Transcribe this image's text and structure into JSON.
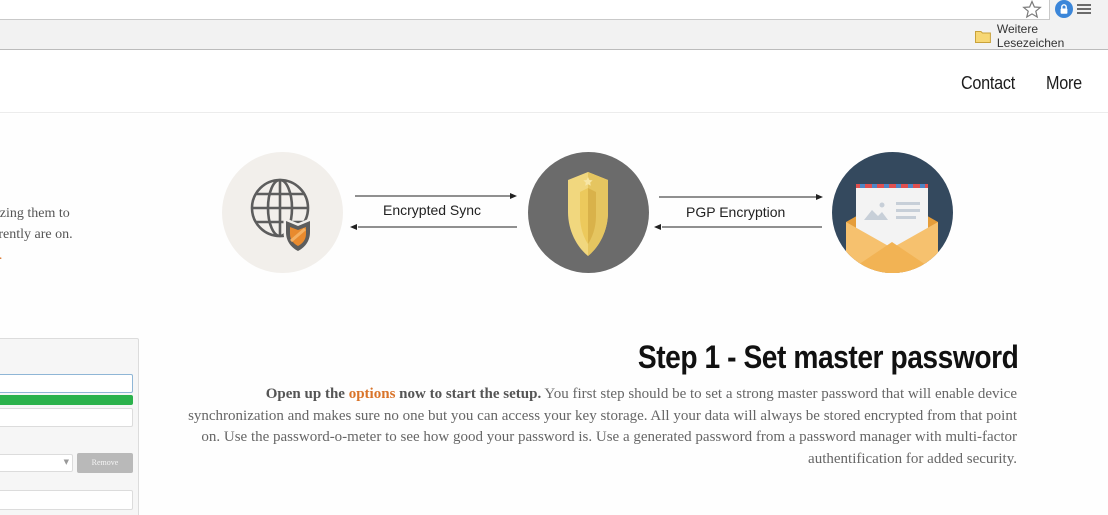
{
  "browser": {
    "bookmark_folder": "Weitere Lesezeichen"
  },
  "nav": {
    "contact": "Contact",
    "more": "More"
  },
  "intro": {
    "line1": "nchronizing them to",
    "line2": "you currently are on.",
    "line3": "t."
  },
  "form_panel": {
    "remove_label": "Remove"
  },
  "diagram": {
    "label_sync": "Encrypted Sync",
    "label_pgp": "PGP Encryption"
  },
  "step": {
    "title": "Step 1 - Set master password",
    "lead_prefix": "Open up the ",
    "lead_link": "options",
    "lead_suffix": " now to start the setup.",
    "body": " You first step should be to set a strong master password that will enable device synchronization and makes sure no one but you can access your key storage. All your data will always be stored encrypted from that point on. Use the password-o-meter to see how good your password is. Use a generated password from a password manager with multi-factor authentification for added security."
  },
  "colors": {
    "accent": "#d9742a",
    "meter_green": "#2bb24c",
    "shield_gold": "#f1d77e",
    "mail_dark": "#34495e"
  },
  "icons": [
    "star-icon",
    "extension-lock-icon",
    "menu-icon",
    "folder-icon",
    "globe-shield-icon",
    "gold-shield-icon",
    "envelope-icon"
  ]
}
